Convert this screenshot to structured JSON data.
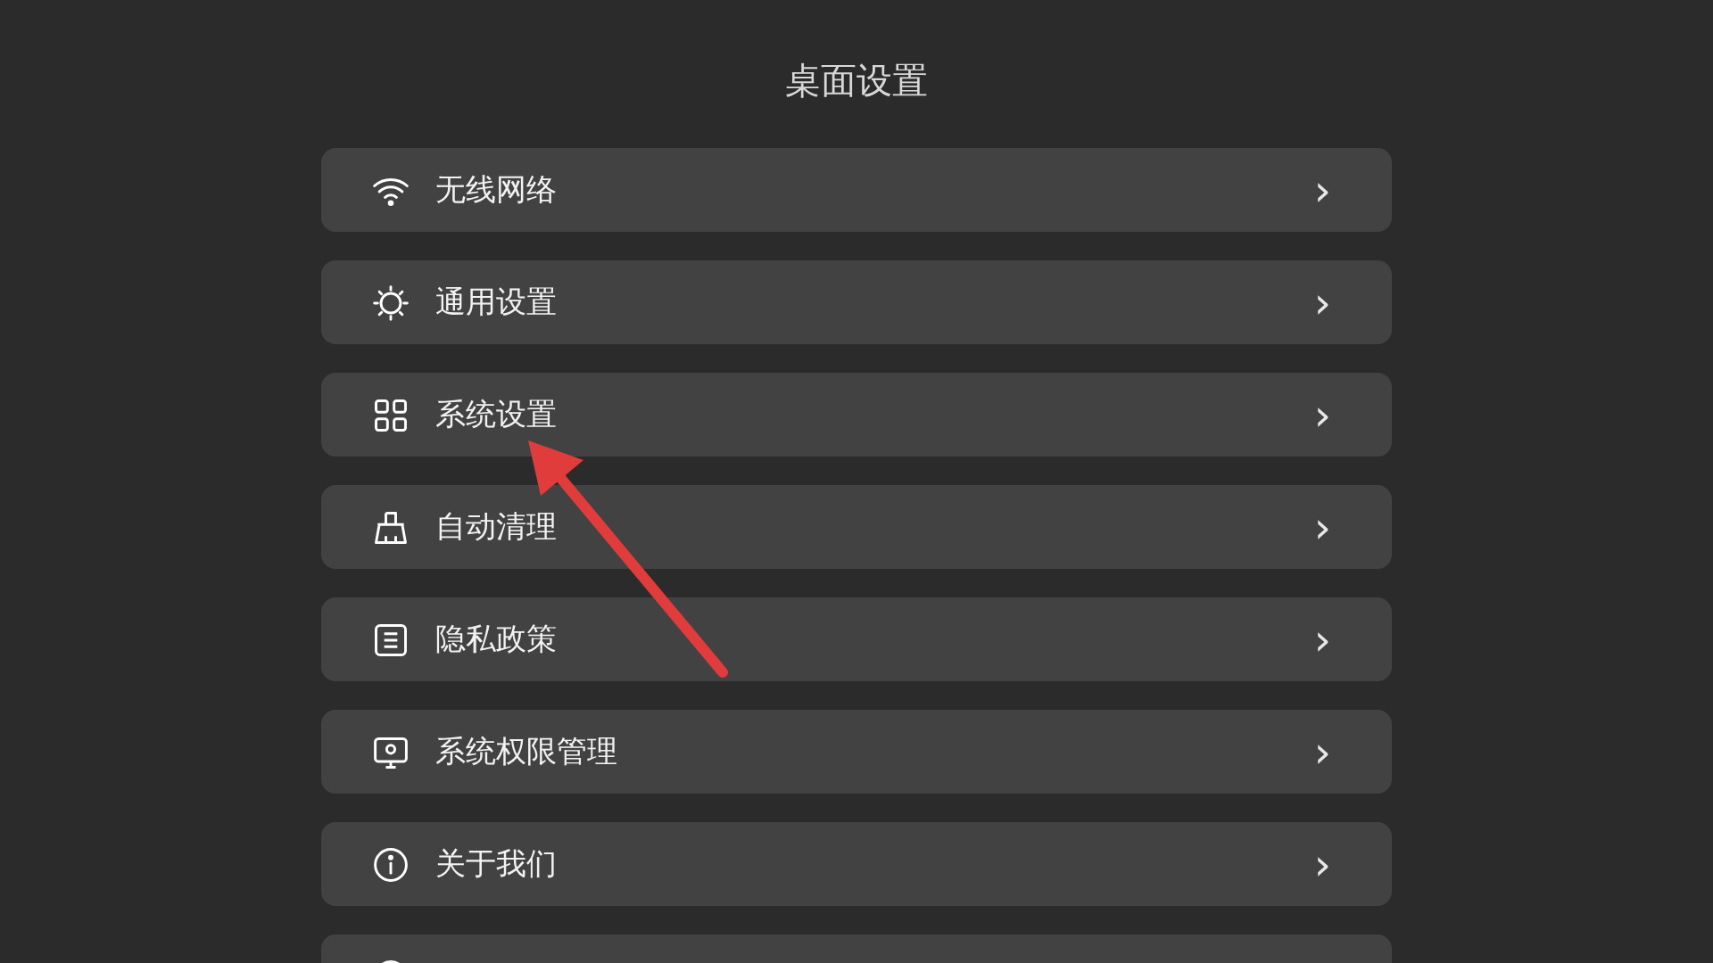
{
  "title": "桌面设置",
  "items": [
    {
      "kind": "wifi",
      "label": "无线网络",
      "chevron": "›"
    },
    {
      "kind": "sun",
      "label": "通用设置",
      "chevron": "›"
    },
    {
      "kind": "grid",
      "label": "系统设置",
      "chevron": "›"
    },
    {
      "kind": "broom",
      "label": "自动清理",
      "chevron": "›"
    },
    {
      "kind": "doc",
      "label": "隐私政策",
      "chevron": "›"
    },
    {
      "kind": "monitor",
      "label": "系统权限管理",
      "chevron": "›"
    },
    {
      "kind": "info",
      "label": "关于我们",
      "chevron": "›"
    },
    {
      "kind": "circle"
    }
  ],
  "annotation": {
    "kind": "arrow"
  }
}
